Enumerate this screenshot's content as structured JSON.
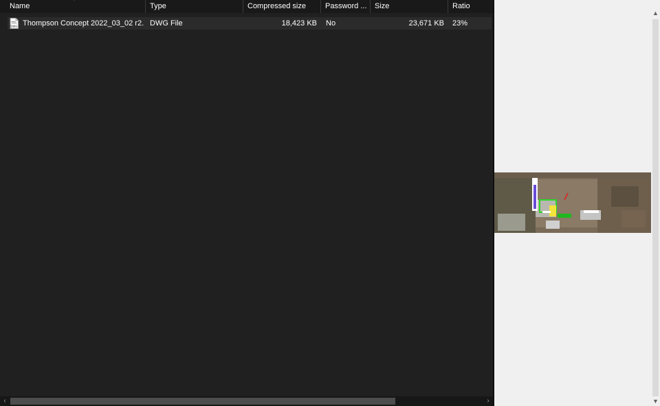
{
  "columns": [
    {
      "key": "name",
      "label": "Name"
    },
    {
      "key": "type",
      "label": "Type"
    },
    {
      "key": "compressed",
      "label": "Compressed size"
    },
    {
      "key": "password",
      "label": "Password ..."
    },
    {
      "key": "size",
      "label": "Size"
    },
    {
      "key": "ratio",
      "label": "Ratio"
    }
  ],
  "files": [
    {
      "name": "Thompson Concept 2022_03_02 r2....",
      "type": "DWG File",
      "compressed": "18,423 KB",
      "password": "No",
      "size": "23,671 KB",
      "ratio": "23%",
      "icon": "dwg-file-icon"
    }
  ],
  "scrollbars": {
    "left_arrow": "<",
    "right_arrow": ">",
    "up_arrow": "^",
    "down_arrow": "v"
  },
  "preview": {
    "description_icon": "aerial-site-plan-thumbnail"
  },
  "colors": {
    "list_background": "#202020",
    "selected_row": "#2b2b2b",
    "preview_background": "#f0f0f0"
  }
}
